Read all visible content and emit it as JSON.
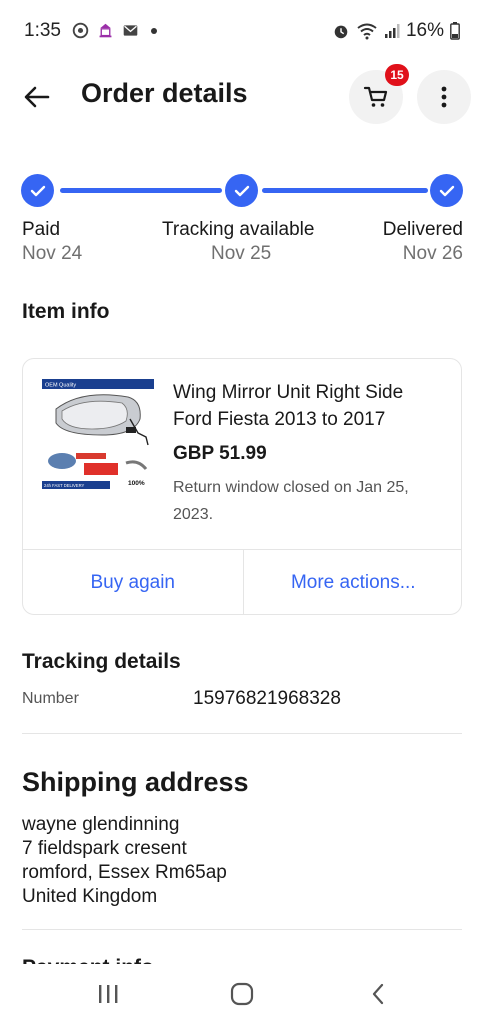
{
  "status_bar": {
    "time": "1:35",
    "battery": "16%",
    "icons": [
      "chrome-icon",
      "temple-icon",
      "mail-icon",
      "dot-icon",
      "alarm-icon",
      "wifi-icon",
      "signal-icon",
      "battery-icon"
    ]
  },
  "app_bar": {
    "title": "Order details",
    "cart_count": "15"
  },
  "tracker": {
    "accent": "#3665f3",
    "steps": [
      {
        "label": "Paid",
        "date": "Nov 24"
      },
      {
        "label": "Tracking available",
        "date": "Nov 25"
      },
      {
        "label": "Delivered",
        "date": "Nov 26"
      }
    ]
  },
  "item_info": {
    "section_title": "Item info",
    "thumbnail_text": {
      "top_banner": "OEM Quality",
      "bottom_banner": "24h FAST DELIVERY",
      "percent": "100%"
    },
    "title": "Wing Mirror Unit Right Side Ford Fiesta 2013 to 2017",
    "price": "GBP 51.99",
    "return_note": "Return window closed on Jan 25, 2023.",
    "buy_again": "Buy again",
    "more_actions": "More actions..."
  },
  "tracking": {
    "section_title": "Tracking details",
    "number_label": "Number",
    "number_value": "15976821968328"
  },
  "shipping": {
    "section_title": "Shipping address",
    "lines": [
      "wayne glendinning",
      "7 fieldspark cresent",
      "romford, Essex Rm65ap",
      "United Kingdom"
    ]
  },
  "next_section_title": "Payment info"
}
